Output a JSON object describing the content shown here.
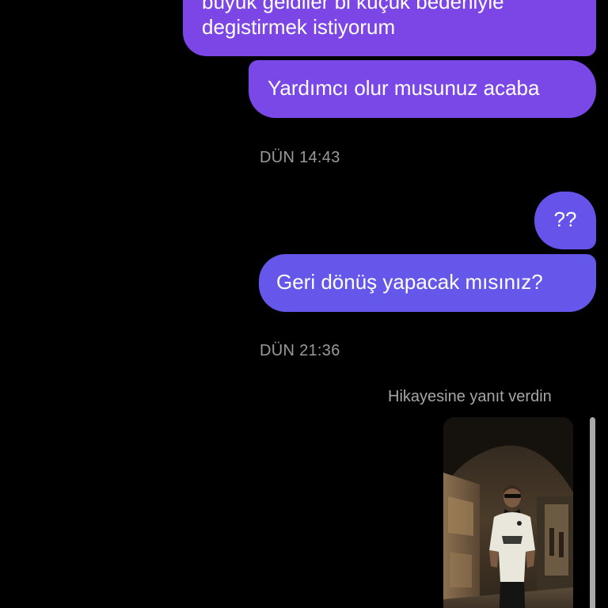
{
  "messages": [
    {
      "line1": "büyük geldiler bi küçük bedeniyle",
      "line2": "degistirmek istiyorum"
    },
    {
      "text": "Yardımcı olur musunuz acaba"
    },
    {
      "timestamp": "DÜN 14:43"
    },
    {
      "text": "??"
    },
    {
      "text": "Geri dönüş yapacak mısınız?"
    },
    {
      "timestamp": "DÜN 21:36"
    }
  ],
  "story_reply": {
    "label": "Hikayesine yanıt verdin"
  },
  "colors": {
    "bubble_purple": "#7c45e6",
    "bubble_indigo": "#6457ea",
    "timestamp_gray": "#9a9a9a",
    "background": "#000000"
  }
}
